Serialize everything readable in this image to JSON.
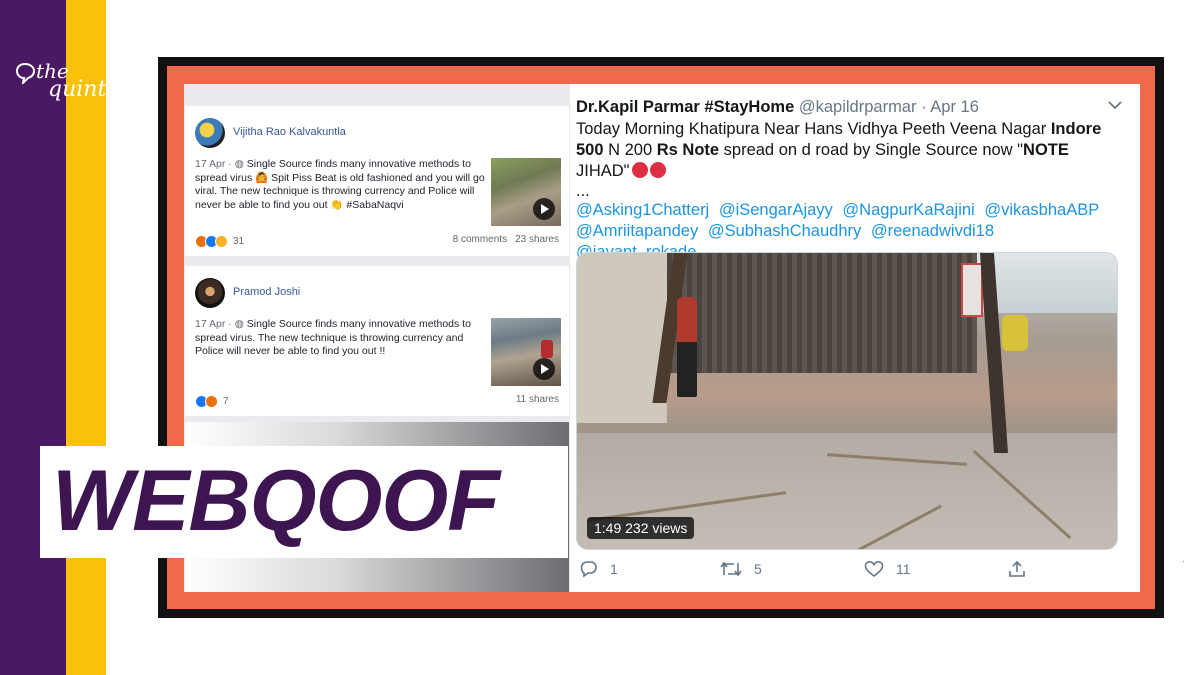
{
  "brand": {
    "logo_line1": "the",
    "logo_line2": "quint",
    "colors": {
      "purple": "#4b1863",
      "yellow": "#f8c10b",
      "frame": "#ef6a4b",
      "banner_text": "#3d1550"
    }
  },
  "banner": {
    "label": "WEBQOOF"
  },
  "facebook": {
    "posts": [
      {
        "author": "Vijitha Rao Kalvakuntla",
        "date": "17 Apr",
        "text": "Single Source finds many innovative methods to spread virus 🙆 Spit Piss Beat is old fashioned and you will go viral. The new technique is throwing currency and Police will never be able to find you out 👏 #SabaNaqvi",
        "reactions": [
          "angry",
          "like",
          "wow"
        ],
        "reaction_count": "31",
        "comments": "8 comments",
        "shares": "23 shares"
      },
      {
        "author": "Pramod Joshi",
        "date": "17 Apr",
        "text": "Single Source finds many innovative methods to spread virus. The new technique is throwing currency and Police will never be able to find you out !!",
        "reactions": [
          "like",
          "angry"
        ],
        "reaction_count": "7",
        "comments": "",
        "shares": "11 shares"
      }
    ]
  },
  "tweet": {
    "display_name": "Dr.Kapil Parmar #StayHome",
    "handle": "@kapildrparmar",
    "separator": "·",
    "date": "Apr 16",
    "text_1": "Today Morning Khatipura Near Hans Vidhya Peeth Veena Nagar ",
    "text_bold_1": "Indore 500",
    "text_2": " N 200 ",
    "text_bold_2": "Rs Note",
    "text_3": " spread on d road by Single Source now \"",
    "text_bold_3": "NOTE",
    "text_4": " JIHAD\"",
    "ellipsis": "...",
    "mentions": [
      "@Asking1Chatterj",
      "@iSengarAjayy",
      "@NagpurKaRajini",
      "@vikasbhaABP",
      "@Amriitapandey",
      "@SubhashChaudhry",
      "@reenadwivdi18",
      "@jayant_rokade"
    ],
    "video": {
      "duration": "1:49",
      "views": "232 views"
    },
    "actions": {
      "replies": "1",
      "retweets": "5",
      "likes": "11"
    }
  }
}
